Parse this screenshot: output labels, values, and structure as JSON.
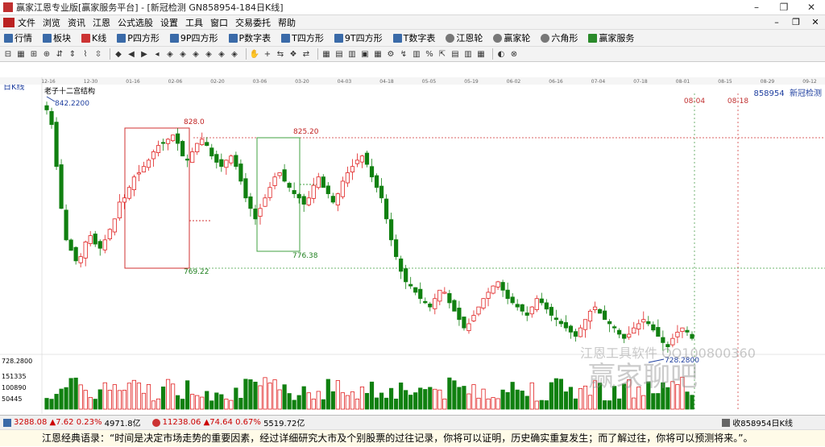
{
  "window": {
    "title": "赢家江恩专业版[赢家服务平台] - [新冠检测  GN858954-184日K线]",
    "controls": [
      "–",
      "❐",
      "✕"
    ]
  },
  "menu": {
    "items": [
      "文件",
      "浏览",
      "资讯",
      "江恩",
      "公式选股",
      "设置",
      "工具",
      "窗口",
      "交易委托",
      "帮助"
    ],
    "right_controls": [
      "–",
      "❐",
      "✕"
    ]
  },
  "toolbar1": {
    "items": [
      "行情",
      "板块",
      "K线",
      "P四方形",
      "9P四方形",
      "P数字表",
      "T四方形",
      "9T四方形",
      "T数字表",
      "江恩轮",
      "赢家轮",
      "六角形",
      "赢家服务"
    ]
  },
  "chart": {
    "period_label": "日K线",
    "code": "858954",
    "name": "新冠检测",
    "study_label": "老子十二宫结构",
    "high_label": "842.2200",
    "low_label": "728.2800",
    "dates": [
      "12-16",
      "12-30",
      "01-16",
      "02-06",
      "02-20",
      "03-06",
      "03-20",
      "04-03",
      "04-18",
      "05-05",
      "05-19",
      "06-02",
      "06-16",
      "07-04",
      "07-18",
      "08-01",
      "08-15",
      "08-29",
      "09-12"
    ],
    "future_dates": [
      "08-04",
      "08-18"
    ],
    "levels": [
      {
        "label": "825.20",
        "color": "#c02020"
      },
      {
        "label": "769.22",
        "color": "#208020"
      },
      {
        "label": "776.38",
        "color": "#208020"
      },
      {
        "label": "828.0",
        "color": "#c02020"
      }
    ],
    "volume_ticks": [
      "151335",
      "100890",
      "50445"
    ],
    "price_axis_label": "728.2800"
  },
  "chart_data": {
    "type": "candlestick",
    "title": "",
    "ylim": [
      725,
      846
    ],
    "values": []
  },
  "status": {
    "sh": {
      "value": "3288.08",
      "change": "▲7.62",
      "pct": "0.23%",
      "amount": "4971.8亿"
    },
    "sz": {
      "value": "11238.06",
      "change": "▲74.64",
      "pct": "0.67%",
      "amount": "5519.72亿"
    },
    "right": "收858954日K线"
  },
  "quote": "江恩经典语录：“时间是决定市场走势的重要因素，经过详细研究大市及个别股票的过往记录，你将可以证明，历史确实重复发生；而了解过往，你将可以预测将来。”。",
  "watermark": {
    "text": "赢家聊吧",
    "sub": "江恩工具软件  QQ100800360"
  }
}
